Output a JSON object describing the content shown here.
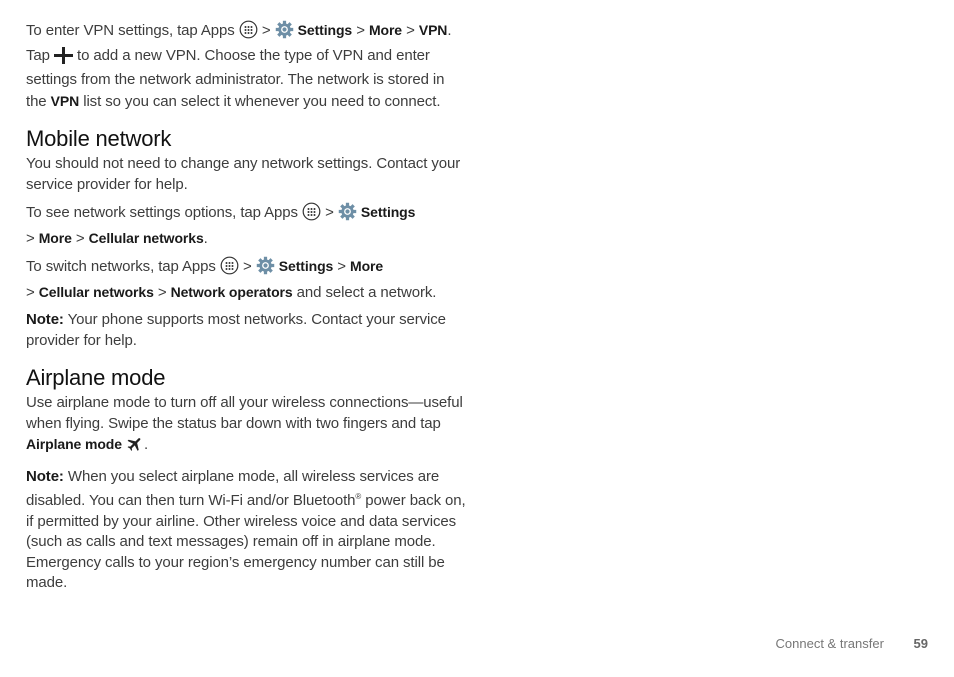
{
  "vpn": {
    "p1": [
      "To enter VPN settings, tap Apps",
      "Settings",
      "More",
      "VPN",
      ". Tap",
      "to add a new VPN. Choose the type of VPN and enter settings from the network administrator. The network is stored in the",
      "VPN",
      "list so you can select it whenever you need to connect."
    ]
  },
  "mobile": {
    "heading": "Mobile network",
    "p1": "You should not need to change any network settings. Contact your service provider for help.",
    "p2": [
      "To see network settings options, tap Apps",
      "Settings",
      "More",
      "Cellular networks",
      "."
    ],
    "p3": [
      "To switch networks, tap Apps",
      "Settings",
      "More",
      "Cellular networks",
      "Network operators",
      "and select a network."
    ],
    "note_label": "Note:",
    "note": "Your phone supports most networks. Contact your service provider for help."
  },
  "airplane": {
    "heading": "Airplane mode",
    "p1": [
      "Use airplane mode to turn off all your wireless connections—useful when flying. Swipe the status bar down with two fingers and tap",
      "Airplane mode",
      "."
    ],
    "note_label": "Note:",
    "note1": "When you select airplane mode, all wireless services are disabled. You can then turn Wi-Fi and/or Bluetooth",
    "reg": "®",
    "note2": "power back on, if permitted by your airline. Other wireless voice and data services (such as calls and text messages) remain off in airplane mode. Emergency calls to your region’s emergency number can still be made."
  },
  "sep": ">",
  "footer": {
    "section": "Connect & transfer",
    "page": "59"
  }
}
